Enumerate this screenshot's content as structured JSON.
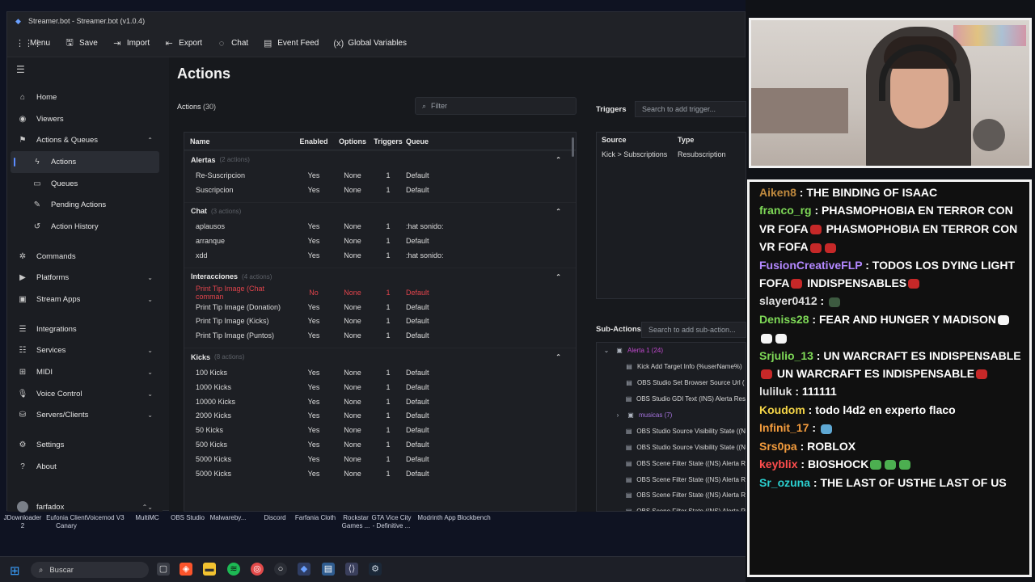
{
  "window": {
    "title": "Streamer.bot - Streamer.bot (v1.0.4)"
  },
  "toolbar": [
    {
      "label": "Menu",
      "icon": "grid-menu-icon",
      "glyph": "⋮⋮⋮"
    },
    {
      "label": "Save",
      "icon": "save-icon",
      "glyph": "🖫"
    },
    {
      "label": "Import",
      "icon": "import-icon",
      "glyph": "⇥"
    },
    {
      "label": "Export",
      "icon": "export-icon",
      "glyph": "⇤"
    },
    {
      "label": "Chat",
      "icon": "chat-icon",
      "glyph": "◌"
    },
    {
      "label": "Event Feed",
      "icon": "event-feed-icon",
      "glyph": "▤"
    },
    {
      "label": "Global Variables",
      "icon": "variables-icon",
      "glyph": "(x)"
    }
  ],
  "sidebar": {
    "items": [
      {
        "label": "Home",
        "icon": "home-icon",
        "glyph": "⌂",
        "type": "top"
      },
      {
        "label": "Viewers",
        "icon": "viewers-icon",
        "glyph": "◉",
        "type": "top"
      },
      {
        "label": "Actions & Queues",
        "icon": "actions-icon",
        "glyph": "⚑",
        "type": "top",
        "chevron": "⌃"
      },
      {
        "label": "Actions",
        "icon": "actions-sub-icon",
        "glyph": "ϟ",
        "type": "active"
      },
      {
        "label": "Queues",
        "icon": "queues-icon",
        "glyph": "▭",
        "type": "sub"
      },
      {
        "label": "Pending Actions",
        "icon": "pending-icon",
        "glyph": "✎",
        "type": "sub"
      },
      {
        "label": "Action History",
        "icon": "history-icon",
        "glyph": "↺",
        "type": "sub"
      },
      {
        "label": "Commands",
        "icon": "commands-icon",
        "glyph": "✲",
        "type": "top"
      },
      {
        "label": "Platforms",
        "icon": "platforms-icon",
        "glyph": "▶",
        "type": "top",
        "chevron": "⌄"
      },
      {
        "label": "Stream Apps",
        "icon": "stream-apps-icon",
        "glyph": "▣",
        "type": "top",
        "chevron": "⌄"
      },
      {
        "label": "Integrations",
        "icon": "integrations-icon",
        "glyph": "☰",
        "type": "top"
      },
      {
        "label": "Services",
        "icon": "services-icon",
        "glyph": "☷",
        "type": "top",
        "chevron": "⌄"
      },
      {
        "label": "MIDI",
        "icon": "midi-icon",
        "glyph": "⊞",
        "type": "top",
        "chevron": "⌄"
      },
      {
        "label": "Voice Control",
        "icon": "voice-icon",
        "glyph": "🎙",
        "type": "top",
        "chevron": "⌄"
      },
      {
        "label": "Servers/Clients",
        "icon": "servers-icon",
        "glyph": "⛁",
        "type": "top",
        "chevron": "⌄"
      },
      {
        "label": "Settings",
        "icon": "settings-icon",
        "glyph": "⚙",
        "type": "top"
      },
      {
        "label": "About",
        "icon": "about-icon",
        "glyph": "?",
        "type": "top"
      }
    ],
    "user": {
      "name": "farfadox",
      "chevron": "⌃⌄"
    }
  },
  "main": {
    "title": "Actions",
    "actions_label": "Actions",
    "actions_count": "(30)",
    "filter_placeholder": "Filter",
    "columns": [
      "Name",
      "Enabled",
      "Options",
      "Triggers",
      "Queue"
    ],
    "groups": [
      {
        "name": "Alertas",
        "meta": "(2 actions)",
        "rows": [
          {
            "name": "Re-Suscripcion",
            "enabled": "Yes",
            "options": "None",
            "triggers": "1",
            "queue": "Default",
            "disabled": false
          },
          {
            "name": "Suscripcion",
            "enabled": "Yes",
            "options": "None",
            "triggers": "1",
            "queue": "Default",
            "disabled": false
          }
        ]
      },
      {
        "name": "Chat",
        "meta": "(3 actions)",
        "rows": [
          {
            "name": "aplausos",
            "enabled": "Yes",
            "options": "None",
            "triggers": "1",
            "queue": ":hat sonido:",
            "disabled": false
          },
          {
            "name": "arranque",
            "enabled": "Yes",
            "options": "None",
            "triggers": "1",
            "queue": "Default",
            "disabled": false
          },
          {
            "name": "xdd",
            "enabled": "Yes",
            "options": "None",
            "triggers": "1",
            "queue": ":hat sonido:",
            "disabled": false
          }
        ]
      },
      {
        "name": "Interacciones",
        "meta": "(4 actions)",
        "rows": [
          {
            "name": "Print Tip Image (Chat comman",
            "enabled": "No",
            "options": "None",
            "triggers": "1",
            "queue": "Default",
            "disabled": true
          },
          {
            "name": "Print Tip Image (Donation)",
            "enabled": "Yes",
            "options": "None",
            "triggers": "1",
            "queue": "Default",
            "disabled": false
          },
          {
            "name": "Print Tip Image (Kicks)",
            "enabled": "Yes",
            "options": "None",
            "triggers": "1",
            "queue": "Default",
            "disabled": false
          },
          {
            "name": "Print Tip Image (Puntos)",
            "enabled": "Yes",
            "options": "None",
            "triggers": "1",
            "queue": "Default",
            "disabled": false
          }
        ]
      },
      {
        "name": "Kicks",
        "meta": "(8 actions)",
        "rows": [
          {
            "name": "100 Kicks",
            "enabled": "Yes",
            "options": "None",
            "triggers": "1",
            "queue": "Default",
            "disabled": false
          },
          {
            "name": "1000 Kicks",
            "enabled": "Yes",
            "options": "None",
            "triggers": "1",
            "queue": "Default",
            "disabled": false
          },
          {
            "name": "10000 Kicks",
            "enabled": "Yes",
            "options": "None",
            "triggers": "1",
            "queue": "Default",
            "disabled": false
          },
          {
            "name": "2000 Kicks",
            "enabled": "Yes",
            "options": "None",
            "triggers": "1",
            "queue": "Default",
            "disabled": false
          },
          {
            "name": "50 Kicks",
            "enabled": "Yes",
            "options": "None",
            "triggers": "1",
            "queue": "Default",
            "disabled": false
          },
          {
            "name": "500 Kicks",
            "enabled": "Yes",
            "options": "None",
            "triggers": "1",
            "queue": "Default",
            "disabled": false
          },
          {
            "name": "5000 Kicks",
            "enabled": "Yes",
            "options": "None",
            "triggers": "1",
            "queue": "Default",
            "disabled": false
          },
          {
            "name": "5000 Kicks",
            "enabled": "Yes",
            "options": "None",
            "triggers": "1",
            "queue": "Default",
            "disabled": false
          }
        ]
      }
    ]
  },
  "triggers": {
    "title": "Triggers",
    "search_placeholder": "Search to add trigger...",
    "columns": [
      "Source",
      "Type"
    ],
    "rows": [
      {
        "source": "Kick > Subscriptions",
        "type": "Resubscription"
      }
    ]
  },
  "subactions": {
    "title": "Sub-Actions",
    "search_placeholder": "Search to add sub-action...",
    "items": [
      {
        "label": "Alerta 1 (24)",
        "kind": "folder",
        "glyph": "▣"
      },
      {
        "label": "Kick Add Target Info (%userName%)",
        "kind": "item",
        "glyph": "▤"
      },
      {
        "label": "OBS Studio Set Browser Source Url (",
        "kind": "item",
        "glyph": "▤"
      },
      {
        "label": "OBS Studio GDI Text (INS) Alerta Res",
        "kind": "item",
        "glyph": "▤"
      },
      {
        "label": "musicas (7)",
        "kind": "folder2",
        "glyph": "▣"
      },
      {
        "label": "OBS Studio Source Visibility State ((N",
        "kind": "item",
        "glyph": "▤"
      },
      {
        "label": "OBS Studio Source Visibility State ((N",
        "kind": "item",
        "glyph": "▤"
      },
      {
        "label": "OBS Scene Filter State ((NS) Alerta R",
        "kind": "item",
        "glyph": "▤"
      },
      {
        "label": "OBS Scene Filter State ((NS) Alerta R",
        "kind": "item",
        "glyph": "▤"
      },
      {
        "label": "OBS Scene Filter State ((NS) Alerta R",
        "kind": "item",
        "glyph": "▤"
      },
      {
        "label": "OBS Scene Filter State ((NS) Alerta R",
        "kind": "item",
        "glyph": "▤"
      }
    ]
  },
  "chat": [
    {
      "user": "Aiken8",
      "color": "#c08a3e",
      "text": "THE BINDING OF ISAAC",
      "emotes": []
    },
    {
      "user": "franco_rg",
      "color": "#7ed957",
      "text": "PHASMOPHOBIA EN TERROR CON VR FOFA",
      "emotes": [
        "#c62828"
      ],
      "text2": "PHASMOPHOBIA EN TERROR CON VR FOFA",
      "emotes2": [
        "#c62828",
        "#c62828"
      ]
    },
    {
      "user": "FusionCreativeFLP",
      "color": "#b388ff",
      "text": "TODOS LOS DYING LIGHT FOFA",
      "emotes": [
        "#c62828"
      ],
      "text2": "INDISPENSABLES",
      "emotes2": [
        "#c62828"
      ]
    },
    {
      "user": "slayer0412",
      "color": "#e0e0e0",
      "text": "",
      "emotes": [
        "#3d5a40"
      ]
    },
    {
      "user": "Deniss28",
      "color": "#7ed957",
      "text": "FEAR AND HUNGER Y MADISON",
      "emotes": [
        "#f5f5f5",
        "#f5f5f5",
        "#f5f5f5"
      ]
    },
    {
      "user": "Srjulio_13",
      "color": "#7ed957",
      "text": "UN WARCRAFT ES INDISPENSABLE",
      "emotes": [
        "#c62828"
      ],
      "text2": "UN WARCRAFT ES INDISPENSABLE",
      "emotes2": [
        "#c62828"
      ]
    },
    {
      "user": "luliluk",
      "color": "#e0e0e0",
      "text": "111111",
      "emotes": []
    },
    {
      "user": "Koudom",
      "color": "#f5d547",
      "text": "todo l4d2 en experto flaco",
      "emotes": []
    },
    {
      "user": "Infinit_17",
      "color": "#f39c3d",
      "text": "",
      "emotes": [
        "#5fa8d3"
      ]
    },
    {
      "user": "Srs0pa",
      "color": "#f39c3d",
      "text": "ROBLOX",
      "emotes": []
    },
    {
      "user": "keyblix",
      "color": "#ff4d4d",
      "text": "BIOSHOCK",
      "emotes": [
        "#4caf50",
        "#4caf50",
        "#4caf50"
      ]
    },
    {
      "user": "Sr_ozuna",
      "color": "#2bd0d0",
      "text": "THE LAST OF USTHE LAST OF US",
      "emotes": []
    }
  ],
  "desktop_icons": [
    {
      "label": "JDownloader 2"
    },
    {
      "label": "Eufonia Client Canary"
    },
    {
      "label": "Voicemod V3"
    },
    {
      "label": "MultiMC"
    },
    {
      "label": "OBS Studio"
    },
    {
      "label": "Malwareby..."
    },
    {
      "label": "Discord"
    },
    {
      "label": "Farfania Cloth"
    },
    {
      "label": "Rockstar Games ..."
    },
    {
      "label": "GTA Vice City - Definitive ..."
    },
    {
      "label": "Modrinth App"
    },
    {
      "label": "Blockbench"
    }
  ],
  "taskbar": {
    "search": "Buscar"
  }
}
